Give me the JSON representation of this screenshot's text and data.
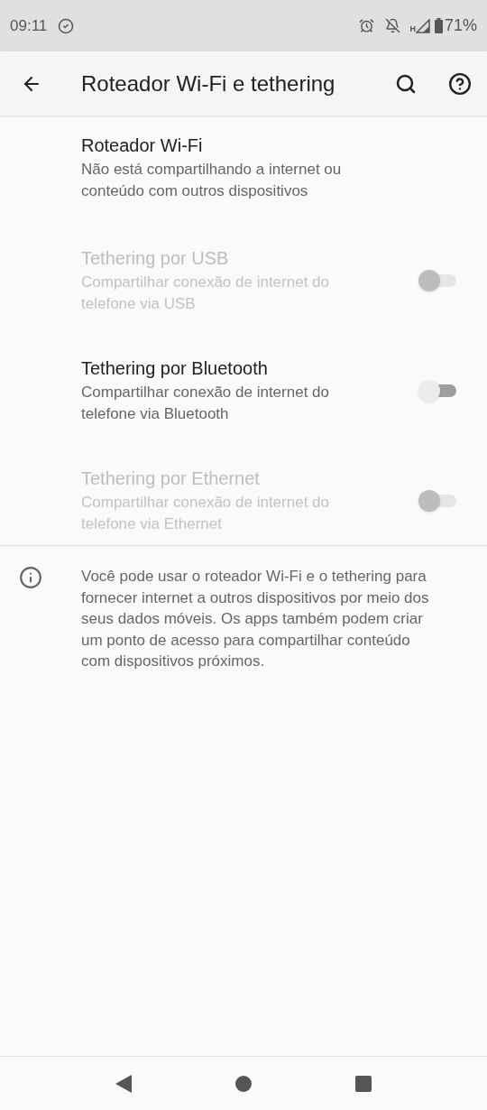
{
  "status_bar": {
    "time": "09:11",
    "network_type": "H",
    "battery": "71%"
  },
  "app_bar": {
    "title": "Roteador Wi-Fi e tethering"
  },
  "settings": [
    {
      "kind": "link",
      "title": "Roteador Wi-Fi",
      "summary": "Não está compartilhando a internet ou conteúdo com outros dispositivos",
      "disabled": false
    },
    {
      "kind": "switch",
      "title": "Tethering por USB",
      "summary": "Compartilhar conexão de internet do telefone via USB",
      "disabled": true,
      "on": false
    },
    {
      "kind": "switch",
      "title": "Tethering por Bluetooth",
      "summary": "Compartilhar conexão de internet do telefone via Bluetooth",
      "disabled": false,
      "on": false
    },
    {
      "kind": "switch",
      "title": "Tethering por Ethernet",
      "summary": "Compartilhar conexão de internet do telefone via Ethernet",
      "disabled": true,
      "on": false
    }
  ],
  "info": "Você pode usar o roteador Wi-Fi e o tethering para fornecer internet a outros dispositivos por meio dos seus dados móveis. Os apps também podem criar um ponto de acesso para compartilhar conteúdo com dispositivos próximos."
}
